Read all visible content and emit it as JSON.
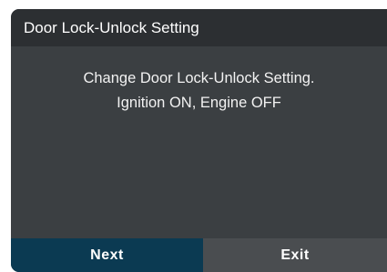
{
  "dialog": {
    "title": "Door Lock-Unlock Setting",
    "message_lines": [
      "Change Door Lock-Unlock Setting.",
      "Ignition ON, Engine OFF"
    ],
    "buttons": {
      "next_label": "Next",
      "exit_label": "Exit"
    }
  },
  "colors": {
    "title_bar": "#2c2f32",
    "body": "#3b3f42",
    "next_button": "#0b3a52",
    "exit_button": "#4a4d50",
    "text": "#ffffff"
  }
}
